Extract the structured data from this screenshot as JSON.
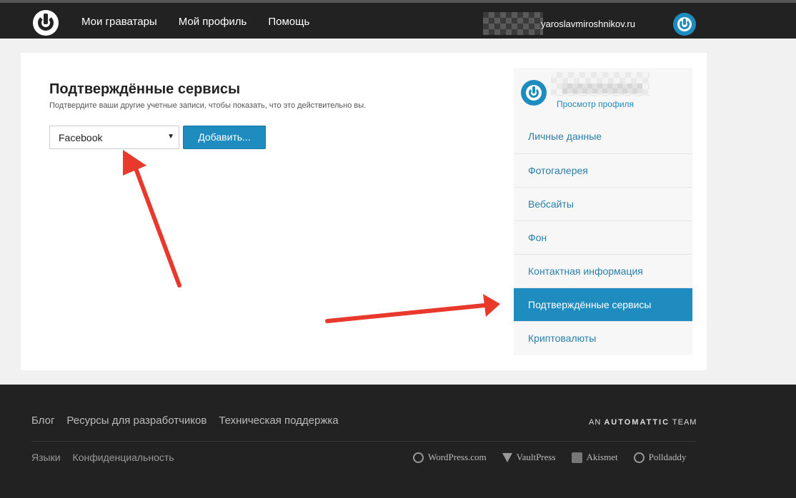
{
  "header": {
    "nav": [
      "Мои граватары",
      "Мой профиль",
      "Помощь"
    ],
    "username": "yaroslavmiroshnikov.ru"
  },
  "main": {
    "title": "Подтверждённые сервисы",
    "subtitle": "Подтвердите ваши другие учетные записи, чтобы показать, что это действительно вы.",
    "service_select": {
      "value": "Facebook"
    },
    "add_button": "Добавить..."
  },
  "sidebar": {
    "view_profile": "Просмотр профиля",
    "items": [
      {
        "label": "Личные данные",
        "active": false
      },
      {
        "label": "Фотогалерея",
        "active": false
      },
      {
        "label": "Вебсайты",
        "active": false
      },
      {
        "label": "Фон",
        "active": false
      },
      {
        "label": "Контактная информация",
        "active": false
      },
      {
        "label": "Подтверждённые сервисы",
        "active": true
      },
      {
        "label": "Криптовалюты",
        "active": false
      }
    ]
  },
  "footer": {
    "links": [
      "Блог",
      "Ресурсы для разработчиков",
      "Техническая поддержка"
    ],
    "automattic_prefix": "AN",
    "automattic_name": "AUTOMATTIC",
    "automattic_suffix": "TEAM",
    "links2": [
      "Языки",
      "Конфиденциальность"
    ],
    "partners": [
      {
        "label": "WordPress.com",
        "icon": "wordpress-icon"
      },
      {
        "label": "VaultPress",
        "icon": "vaultpress-icon"
      },
      {
        "label": "Akismet",
        "icon": "akismet-icon"
      },
      {
        "label": "Polldaddy",
        "icon": "polldaddy-icon"
      }
    ]
  },
  "colors": {
    "accent": "#1e8cbe",
    "topbar": "#222222",
    "arrow": "#e8392c"
  }
}
